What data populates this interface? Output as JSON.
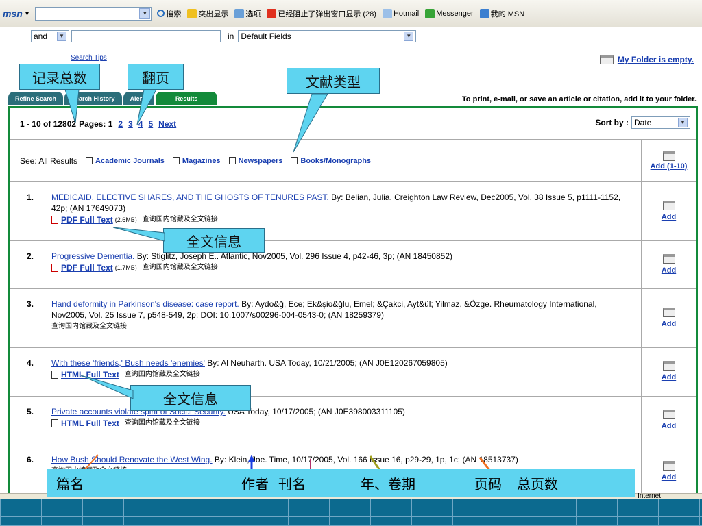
{
  "toolbar": {
    "logo": "msn",
    "search": "搜索",
    "highlight": "突出显示",
    "options": "选项",
    "popup": "已经阻止了弹出窗口显示 (28)",
    "hotmail": "Hotmail",
    "messenger": "Messenger",
    "mymsn": "我的 MSN"
  },
  "search_row": {
    "bool": "and",
    "in_label": "in",
    "field": "Default Fields"
  },
  "search_tips": "Search Tips",
  "folder": "My Folder is empty.",
  "tabs": [
    "Refine Search",
    "Search History",
    "Alerts",
    "Results"
  ],
  "print_note": "To print, e-mail, or save an article or citation, add it to your folder.",
  "pager": {
    "range": "1 - 10 of 12802",
    "pages_label": "Pages: 1",
    "pages": [
      "2",
      "3",
      "4",
      "5"
    ],
    "next": "Next",
    "sort_label": "Sort by :",
    "sort_value": "Date"
  },
  "see_all": {
    "label": "See: All Results",
    "types": [
      "Academic Journals",
      "Magazines",
      "Newspapers",
      "Books/Monographs"
    ],
    "add_all": "Add (1-10)"
  },
  "records": [
    {
      "num": "1.",
      "title": "MEDICAID, ELECTIVE SHARES, AND THE GHOSTS OF TENURES PAST.",
      "meta": " By: Belian, Julia. Creighton Law Review, Dec2005, Vol. 38 Issue 5, p1111-1152, 42p; (AN 17649073)",
      "fulltext": "PDF Full Text",
      "size": "(2.6MB)",
      "cn": "查询国内馆藏及全文链接",
      "add": "Add"
    },
    {
      "num": "2.",
      "title": "Progressive Dementia.",
      "meta": " By: Stiglitz, Joseph E.. Atlantic, Nov2005, Vol. 296 Issue 4, p42-46, 3p; (AN 18450852)",
      "fulltext": "PDF Full Text",
      "size": "(1.7MB)",
      "cn": "查询国内馆藏及全文链接",
      "add": "Add"
    },
    {
      "num": "3.",
      "title": "Hand deformity in Parkinson's disease: case report.",
      "meta": " By: Aydo&ğ, Ece; Ek&şio&ğlu, Emel; &Çakci, Ayt&ül; Yilmaz, &Özge. Rheumatology International, Nov2005, Vol. 25 Issue 7, p548-549, 2p; DOI: 10.1007/s00296-004-0543-0; (AN 18259379)",
      "fulltext": "",
      "size": "",
      "cn": "查询国内馆藏及全文链接",
      "add": "Add"
    },
    {
      "num": "4.",
      "title": "With these 'friends,' Bush needs 'enemies'",
      "meta": " By: Al Neuharth. USA Today, 10/21/2005; (AN J0E120267059805)",
      "fulltext": "HTML Full Text",
      "size": "",
      "cn": "查询国内馆藏及全文链接",
      "add": "Add"
    },
    {
      "num": "5.",
      "title": "Private accounts violate spirit of Social Security.",
      "meta": " USA Today, 10/17/2005; (AN J0E398003311105)",
      "fulltext": "HTML Full Text",
      "size": "",
      "cn": "查询国内馆藏及全文链接",
      "add": "Add"
    },
    {
      "num": "6.",
      "title": "How Bush Should Renovate the West Wing.",
      "meta": " By: Klein, Joe. Time, 10/17/2005, Vol. 166 Issue 16, p29-29, 1p, 1c; (AN 18513737)",
      "fulltext": "",
      "size": "",
      "cn": "查询国内馆藏及全文链接",
      "add": "Add"
    }
  ],
  "callouts": {
    "total": "记录总数",
    "paging": "翻页",
    "doctype": "文献类型",
    "fulltext1": "全文信息",
    "fulltext2": "全文信息"
  },
  "bottom_labels": [
    "篇名",
    "作者",
    "刊名",
    "年、卷期",
    "页码",
    "总页数"
  ],
  "status_text": "Internet"
}
